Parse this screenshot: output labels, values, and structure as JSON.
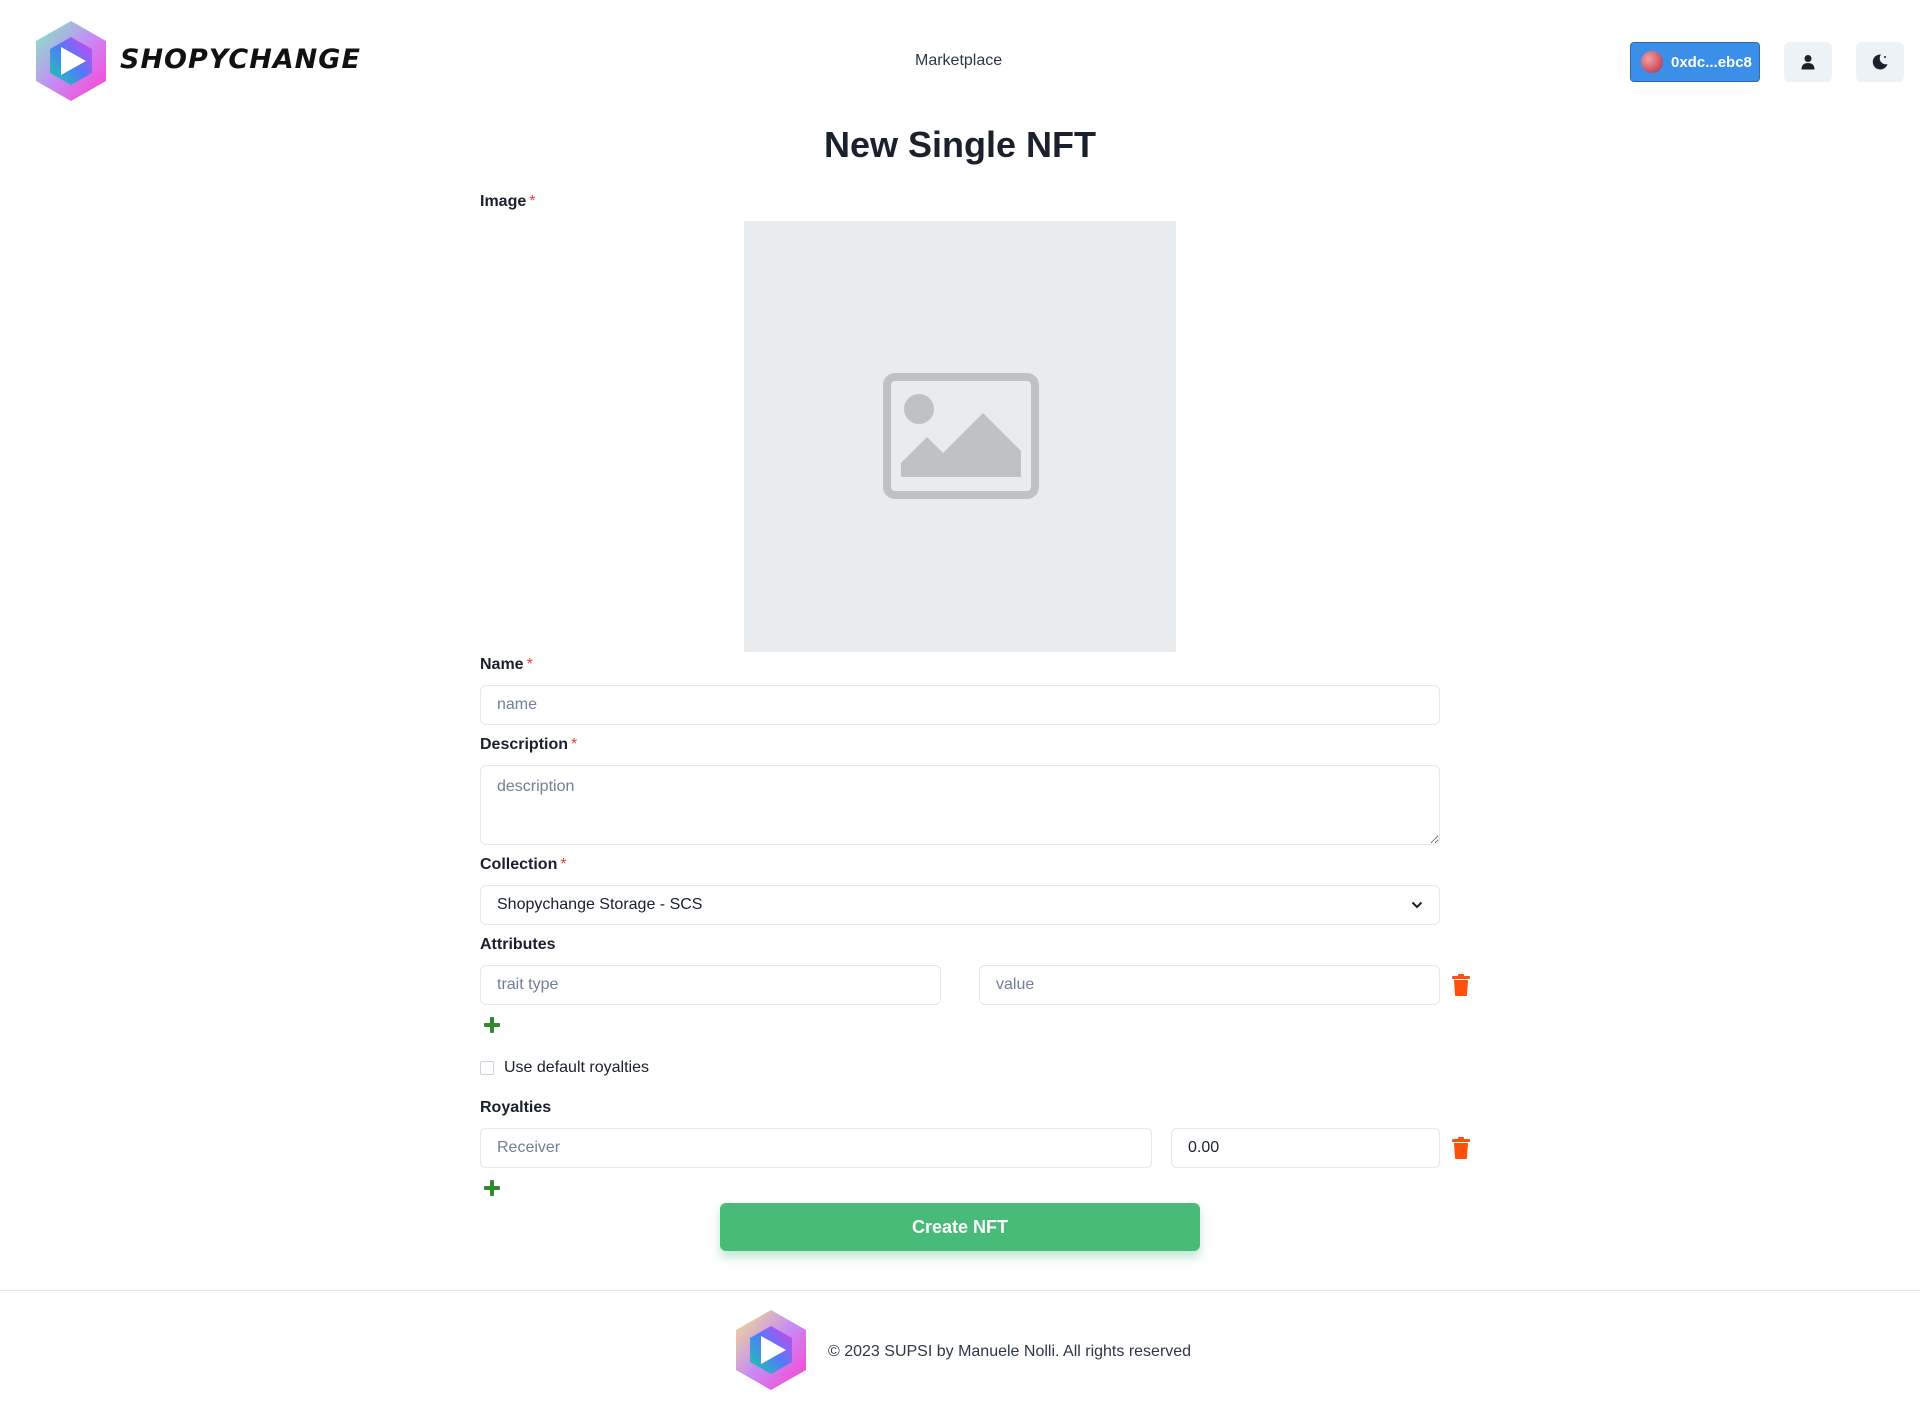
{
  "brand": {
    "name": "SHOPYCHANGE"
  },
  "nav": {
    "marketplace": "Marketplace"
  },
  "wallet": {
    "address": "0xdc...ebc8"
  },
  "page": {
    "title": "New Single NFT"
  },
  "form": {
    "image_label": "Image",
    "name_label": "Name",
    "name_placeholder": "name",
    "description_label": "Description",
    "description_placeholder": "description",
    "collection_label": "Collection",
    "collection_selected": "Shopychange Storage - SCS",
    "attributes_label": "Attributes",
    "trait_placeholder": "trait type",
    "value_placeholder": "value",
    "default_royalties_label": "Use default royalties",
    "default_royalties_checked": false,
    "royalties_label": "Royalties",
    "receiver_placeholder": "Receiver",
    "royalty_value": "0.00",
    "required_mark": "*",
    "submit_label": "Create NFT"
  },
  "footer": {
    "text": "© 2023 SUPSI by Manuele Nolli. All rights reserved"
  },
  "colors": {
    "primary": "#3b8fe8",
    "success": "#48bb78",
    "danger": "#ff4f0f",
    "add": "#2f8a2f"
  },
  "icons": [
    "logo-icon",
    "user-icon",
    "moon-icon",
    "image-placeholder-icon",
    "chevron-down-icon",
    "trash-icon",
    "plus-icon"
  ]
}
